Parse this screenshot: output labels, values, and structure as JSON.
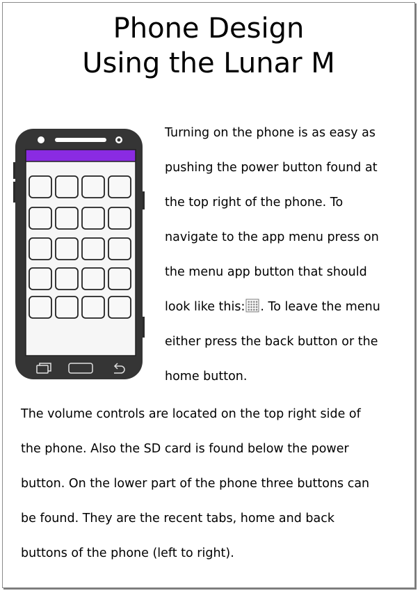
{
  "title": {
    "line1": "Phone Design",
    "line2": "Using the Lunar M"
  },
  "paragraph1": {
    "lines": [
      "Turning on the phone is as easy as",
      "pushing the power button found at",
      "the top right of the phone. To",
      "navigate to the app menu press on",
      "the menu app button that should",
      "look like this:",
      "either press the back button or the",
      "home button."
    ],
    "after_icon": ". To leave the menu"
  },
  "paragraph2": {
    "lines": [
      "The volume controls are located on the top right side of",
      "the phone. Also the SD card is found below the power",
      "button. On the lower part of the phone three buttons can",
      "be found. They are the recent tabs, home and back",
      "buttons of the phone (left to right)."
    ]
  },
  "icons": {
    "menu_icon": "app-menu-grid-icon",
    "recent": "recent-tabs-icon",
    "home": "home-button-icon",
    "back": "back-arrow-icon"
  },
  "colors": {
    "phone_body": "#353535",
    "status_bar": "#8a2be2",
    "screen": "#f5f5f5",
    "app_tile_border": "#222222"
  }
}
